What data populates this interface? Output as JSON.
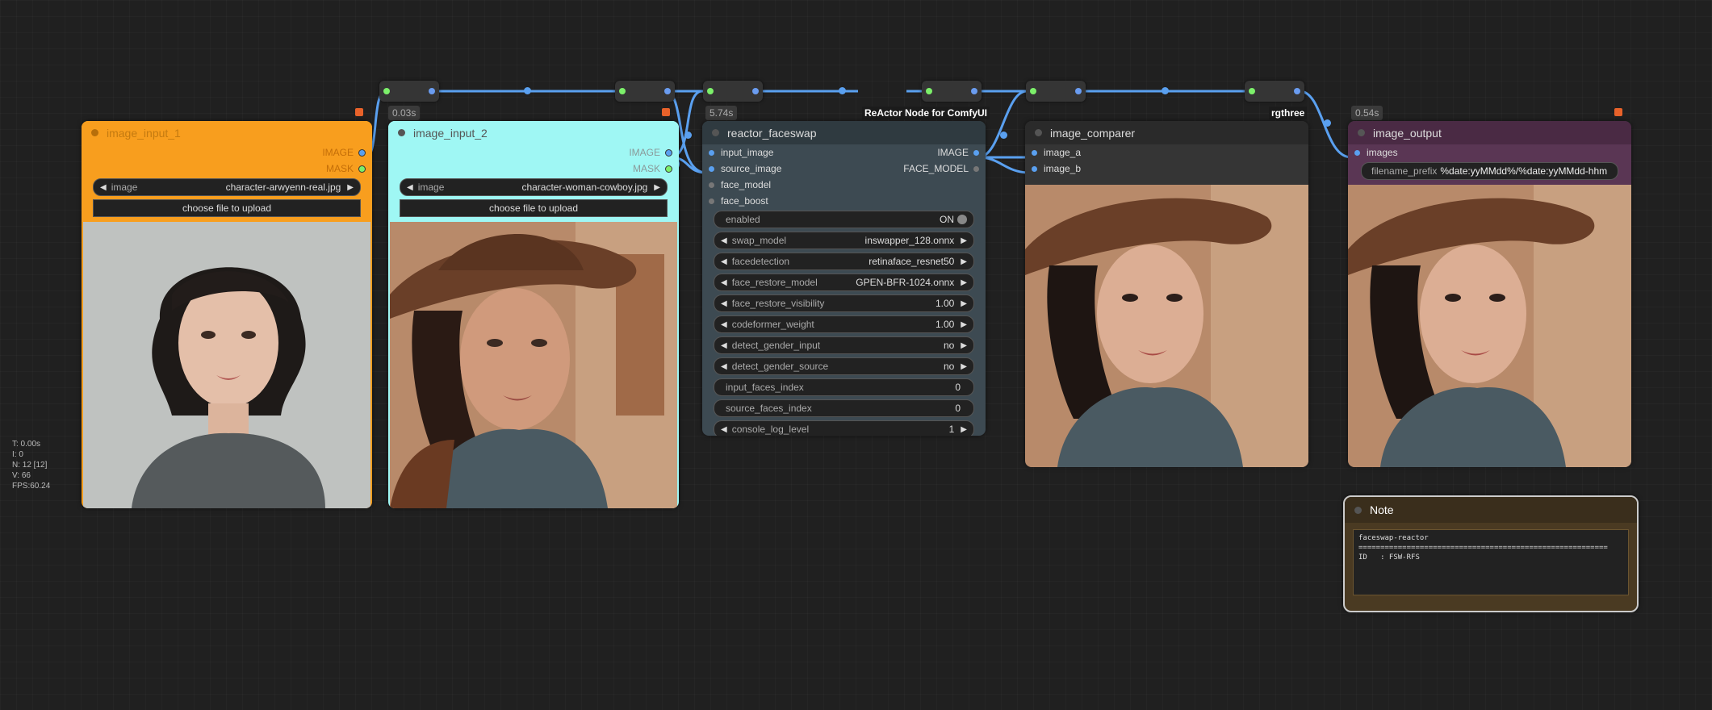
{
  "stats": {
    "t": "T: 0.00s",
    "i": "I: 0",
    "n": "N: 12 [12]",
    "v": "V: 66",
    "fps": "FPS:60.24"
  },
  "badges": {
    "input2_time": "0.03s",
    "faceswap_time": "5.74s",
    "faceswap_src": "ReActor Node for ComfyUI",
    "comparer_src": "rgthree",
    "output_time": "0.54s"
  },
  "image_input_1": {
    "title": "image_input_1",
    "out_image": "IMAGE",
    "out_mask": "MASK",
    "widget_label": "image",
    "widget_value": "character-arwyenn-real.jpg",
    "upload": "choose file to upload",
    "color": "#f89e1e"
  },
  "image_input_2": {
    "title": "image_input_2",
    "out_image": "IMAGE",
    "out_mask": "MASK",
    "widget_label": "image",
    "widget_value": "character-woman-cowboy.jpg",
    "upload": "choose file to upload",
    "color": "#9ff7f4"
  },
  "reactor": {
    "title": "reactor_faceswap",
    "inputs": [
      "input_image",
      "source_image",
      "face_model",
      "face_boost"
    ],
    "outputs": [
      "IMAGE",
      "FACE_MODEL"
    ],
    "enabled_label": "enabled",
    "enabled_value": "ON",
    "widgets": [
      {
        "label": "swap_model",
        "value": "inswapper_128.onnx",
        "arrows": true
      },
      {
        "label": "facedetection",
        "value": "retinaface_resnet50",
        "arrows": true
      },
      {
        "label": "face_restore_model",
        "value": "GPEN-BFR-1024.onnx",
        "arrows": true
      },
      {
        "label": "face_restore_visibility",
        "value": "1.00",
        "arrows": true
      },
      {
        "label": "codeformer_weight",
        "value": "1.00",
        "arrows": true
      },
      {
        "label": "detect_gender_input",
        "value": "no",
        "arrows": true
      },
      {
        "label": "detect_gender_source",
        "value": "no",
        "arrows": true
      },
      {
        "label": "input_faces_index",
        "value": "0",
        "arrows": false
      },
      {
        "label": "source_faces_index",
        "value": "0",
        "arrows": false
      },
      {
        "label": "console_log_level",
        "value": "1",
        "arrows": true
      }
    ]
  },
  "comparer": {
    "title": "image_comparer",
    "in_a": "image_a",
    "in_b": "image_b"
  },
  "output": {
    "title": "image_output",
    "in_images": "images",
    "prefix_label": "filename_prefix",
    "prefix_value": "%date:yyMMdd%/%date:yyMMdd-hhm"
  },
  "note": {
    "title": "Note",
    "text": "faceswap-reactor\n=========================================================\nID   : FSW-RFS"
  },
  "colors": {
    "link": "#5aa0f0",
    "reroute_in": "#7cf06a",
    "accent_orange": "#f89e1e",
    "accent_cyan": "#9ff7f4",
    "reactor_body": "#3d4a52",
    "output_title": "#4a2a44",
    "note_frame": "#6b5530"
  }
}
